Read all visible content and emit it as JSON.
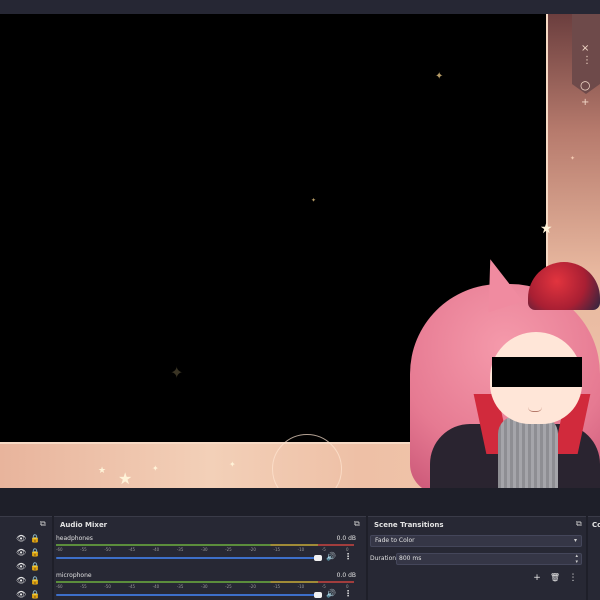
{
  "preview": {
    "overlay_colors": {
      "frame": "#f0c8ae",
      "accent_tab": "#6e4a4a"
    },
    "overlay_controls": [
      "close-icon",
      "dots-icon",
      "ring-icon",
      "plus-icon"
    ],
    "overlay_glyphs": {
      "close": "×",
      "dots": "⋮",
      "ring": "○",
      "plus": "+"
    }
  },
  "dock": {
    "sources": {
      "rows": [
        {
          "eye": "👁",
          "lock": "🔒"
        },
        {
          "eye": "👁",
          "lock": "🔒"
        },
        {
          "eye": "👁",
          "lock": "🔒"
        },
        {
          "eye": "👁",
          "lock": "🔒"
        },
        {
          "eye": "👁",
          "lock": "🔒"
        }
      ]
    },
    "audio_mixer": {
      "title": "Audio Mixer",
      "tracks": [
        {
          "name": "headphones",
          "db": "0.0 dB"
        },
        {
          "name": "microphone",
          "db": "0.0 dB"
        }
      ],
      "ticks": [
        "-60",
        "-55",
        "-50",
        "-45",
        "-40",
        "-35",
        "-30",
        "-25",
        "-20",
        "-15",
        "-10",
        "-5",
        "0"
      ],
      "volume_level": 1.0,
      "volume_icon": "🔊",
      "menu_icon": "⋮"
    },
    "scene_transitions": {
      "title": "Scene Transitions",
      "transition": "Fade to Color",
      "duration_label": "Duration",
      "duration_value": "800 ms",
      "add_icon": "+",
      "remove_icon": "🗑",
      "menu_icon": "⋮"
    },
    "controls": {
      "title": "Co"
    },
    "undock_icon": "⧉"
  }
}
